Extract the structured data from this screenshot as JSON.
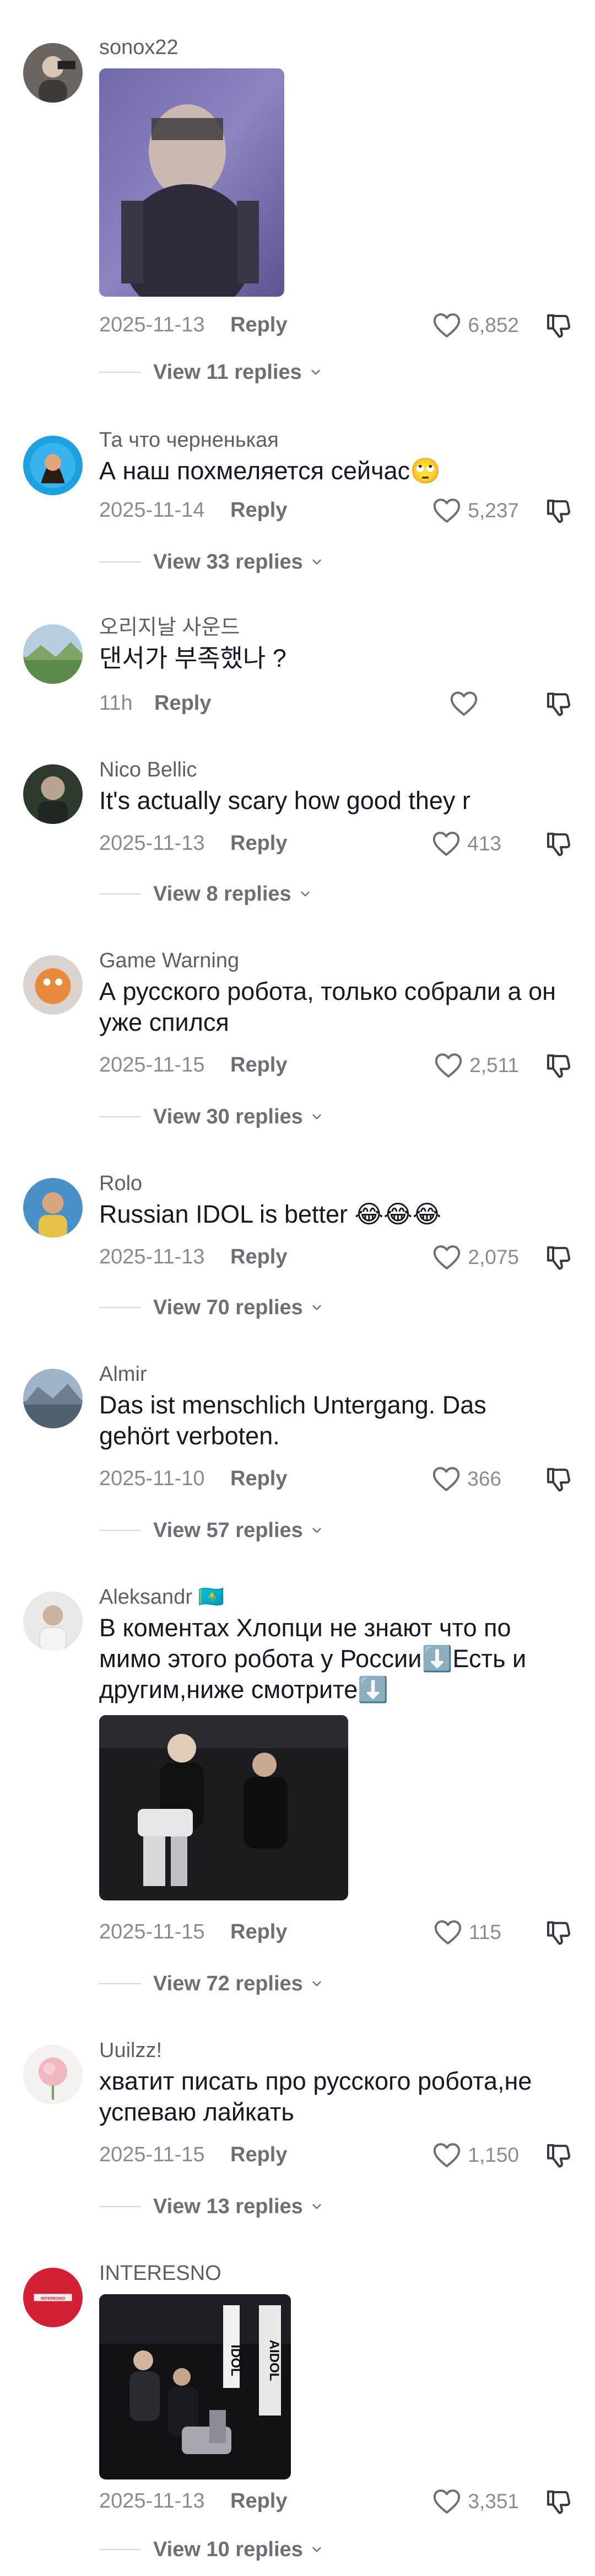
{
  "labels": {
    "reply": "Reply"
  },
  "comments": [
    {
      "username": "sonox22",
      "text": "",
      "date": "2025-11-13",
      "likes": "6,852",
      "replies": "View 11 replies"
    },
    {
      "username": "Та что черненькая",
      "text": "А наш похмеляется сейчас🙄",
      "date": "2025-11-14",
      "likes": "5,237",
      "replies": "View 33 replies"
    },
    {
      "username": "오리지날 사운드",
      "text": "댄서가 부족했나 ?",
      "date": "11h",
      "likes": "",
      "replies": ""
    },
    {
      "username": "Nico Bellic",
      "text": "It's actually scary how good they r",
      "date": "2025-11-13",
      "likes": "413",
      "replies": "View 8 replies"
    },
    {
      "username": "Game Warning",
      "text": "А русского робота, только собрали а он уже спился",
      "date": "2025-11-15",
      "likes": "2,511",
      "replies": "View 30 replies"
    },
    {
      "username": "Rolo",
      "text": "Russian IDOL is better 😂😂😂",
      "date": "2025-11-13",
      "likes": "2,075",
      "replies": "View 70 replies"
    },
    {
      "username": "Almir",
      "text": "Das ist menschlich Untergang. Das gehört verboten.",
      "date": "2025-11-10",
      "likes": "366",
      "replies": "View 57 replies"
    },
    {
      "username": "Aleksandr 🇰🇿",
      "text": "В коментах Хлопци не знают что по мимо этого робота у России⬇️Есть и другим,ниже смотрите⬇️",
      "date": "2025-11-15",
      "likes": "115",
      "replies": "View 72 replies"
    },
    {
      "username": "Uuilzz!",
      "text": "хватит писать про русского робота,не успеваю лайкать",
      "date": "2025-11-15",
      "likes": "1,150",
      "replies": "View 13 replies"
    },
    {
      "username": "INTERESNO",
      "text": "",
      "date": "2025-11-13",
      "likes": "3,351",
      "replies": "View 10 replies"
    }
  ],
  "media_text": {
    "idol_sign_1": "IDOL",
    "idol_sign_2": "AIDOL",
    "avatar_logo": "INTERESNO"
  },
  "colors": {
    "text": "#161823",
    "muted": "#8a8b91",
    "username": "#5e5e66"
  },
  "icons": [
    "heart-icon",
    "dislike-icon",
    "chevron-down-icon"
  ]
}
